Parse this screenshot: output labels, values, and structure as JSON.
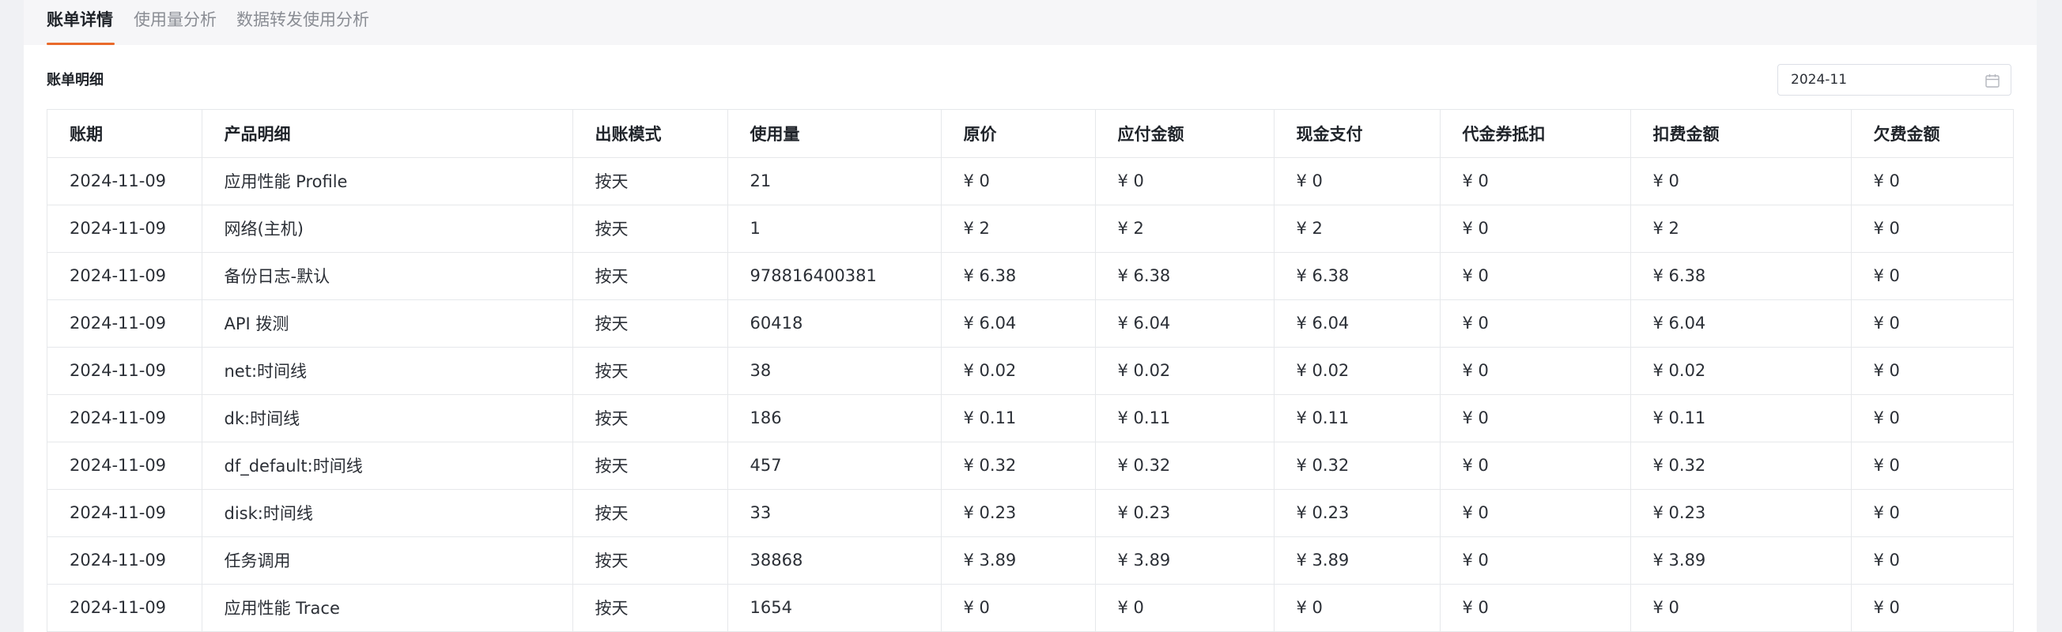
{
  "tabs": [
    {
      "label": "账单详情",
      "active": true
    },
    {
      "label": "使用量分析",
      "active": false
    },
    {
      "label": "数据转发使用分析",
      "active": false
    }
  ],
  "section": {
    "title": "账单明细"
  },
  "month_picker": {
    "value": "2024-11",
    "icon": "calendar-icon"
  },
  "table": {
    "columns": [
      "账期",
      "产品明细",
      "出账模式",
      "使用量",
      "原价",
      "应付金额",
      "现金支付",
      "代金券抵扣",
      "扣费金额",
      "欠费金额"
    ],
    "rows": [
      [
        "2024-11-09",
        "应用性能 Profile",
        "按天",
        "21",
        "¥ 0",
        "¥ 0",
        "¥ 0",
        "¥ 0",
        "¥ 0",
        "¥ 0"
      ],
      [
        "2024-11-09",
        "网络(主机)",
        "按天",
        "1",
        "¥ 2",
        "¥ 2",
        "¥ 2",
        "¥ 0",
        "¥ 2",
        "¥ 0"
      ],
      [
        "2024-11-09",
        "备份日志-默认",
        "按天",
        "978816400381",
        "¥ 6.38",
        "¥ 6.38",
        "¥ 6.38",
        "¥ 0",
        "¥ 6.38",
        "¥ 0"
      ],
      [
        "2024-11-09",
        "API 拨测",
        "按天",
        "60418",
        "¥ 6.04",
        "¥ 6.04",
        "¥ 6.04",
        "¥ 0",
        "¥ 6.04",
        "¥ 0"
      ],
      [
        "2024-11-09",
        "net:时间线",
        "按天",
        "38",
        "¥ 0.02",
        "¥ 0.02",
        "¥ 0.02",
        "¥ 0",
        "¥ 0.02",
        "¥ 0"
      ],
      [
        "2024-11-09",
        "dk:时间线",
        "按天",
        "186",
        "¥ 0.11",
        "¥ 0.11",
        "¥ 0.11",
        "¥ 0",
        "¥ 0.11",
        "¥ 0"
      ],
      [
        "2024-11-09",
        "df_default:时间线",
        "按天",
        "457",
        "¥ 0.32",
        "¥ 0.32",
        "¥ 0.32",
        "¥ 0",
        "¥ 0.32",
        "¥ 0"
      ],
      [
        "2024-11-09",
        "disk:时间线",
        "按天",
        "33",
        "¥ 0.23",
        "¥ 0.23",
        "¥ 0.23",
        "¥ 0",
        "¥ 0.23",
        "¥ 0"
      ],
      [
        "2024-11-09",
        "任务调用",
        "按天",
        "38868",
        "¥ 3.89",
        "¥ 3.89",
        "¥ 3.89",
        "¥ 0",
        "¥ 3.89",
        "¥ 0"
      ],
      [
        "2024-11-09",
        "应用性能 Trace",
        "按天",
        "1654",
        "¥ 0",
        "¥ 0",
        "¥ 0",
        "¥ 0",
        "¥ 0",
        "¥ 0"
      ]
    ]
  },
  "colors": {
    "accent": "#e96a2b",
    "background": "#f0f1f4",
    "panel": "#ffffff"
  }
}
